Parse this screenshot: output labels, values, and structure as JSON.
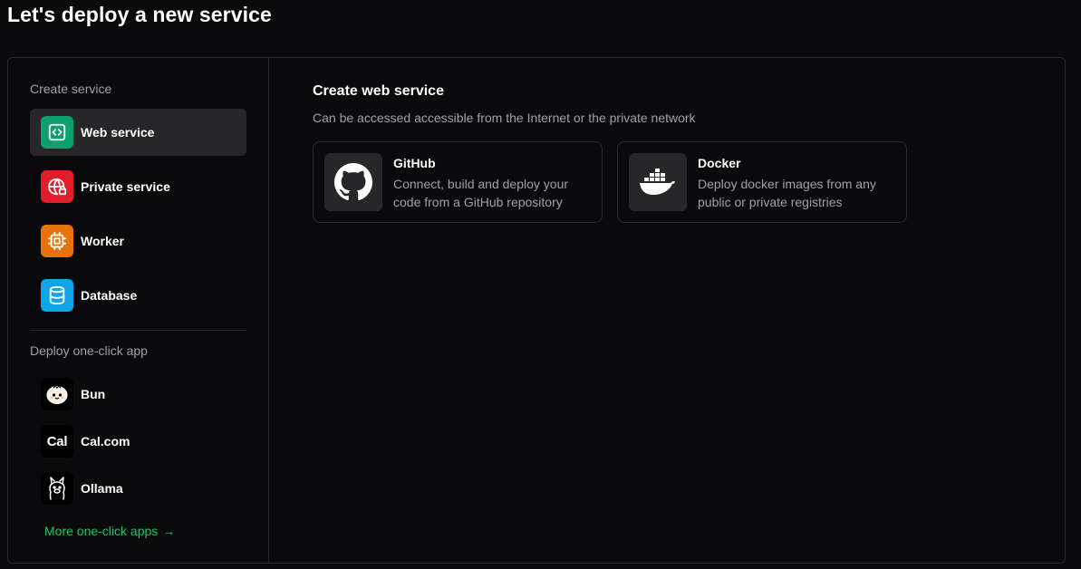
{
  "page": {
    "title": "Let's deploy a new service"
  },
  "sidebar": {
    "create_label": "Create service",
    "items": [
      {
        "label": "Web service",
        "icon": "code-icon",
        "color": "#0e9f6e",
        "active": true
      },
      {
        "label": "Private service",
        "icon": "globe-lock-icon",
        "color": "#e11d2a",
        "active": false
      },
      {
        "label": "Worker",
        "icon": "cpu-icon",
        "color": "#e8730c",
        "active": false
      },
      {
        "label": "Database",
        "icon": "database-icon",
        "color": "#0ea5e9",
        "active": false
      }
    ],
    "oneclick_label": "Deploy one-click app",
    "apps": [
      {
        "label": "Bun",
        "icon": "bun-logo-icon"
      },
      {
        "label": "Cal.com",
        "icon": "cal-logo-icon",
        "logo_text": "Cal"
      },
      {
        "label": "Ollama",
        "icon": "ollama-logo-icon"
      }
    ],
    "more_link": "More one-click apps",
    "more_arrow": "→",
    "accent": "#22c55e"
  },
  "main": {
    "title": "Create web service",
    "subtitle": "Can be accessed accessible from the Internet or the private network",
    "cards": [
      {
        "title": "GitHub",
        "description": "Connect, build and deploy your code from a GitHub repository",
        "icon": "github-icon"
      },
      {
        "title": "Docker",
        "description": "Deploy docker images from any public or private registries",
        "icon": "docker-icon"
      }
    ]
  }
}
